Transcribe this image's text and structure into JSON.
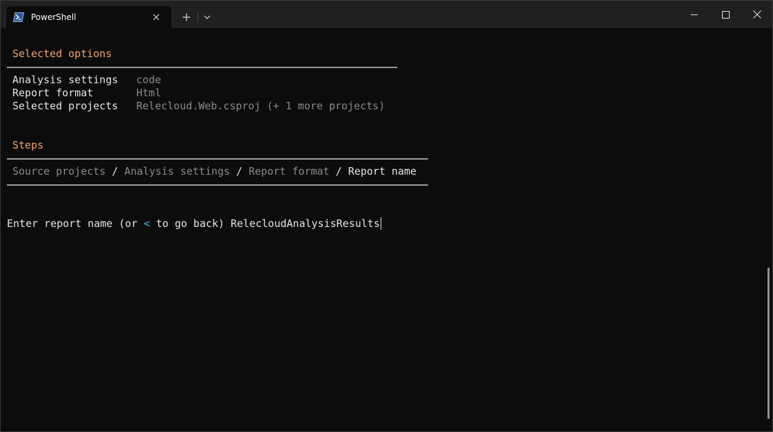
{
  "window": {
    "tab_title": "PowerShell"
  },
  "colors": {
    "heading": "#f2a36a",
    "value": "#8a8a8a",
    "label": "#e4e4e4",
    "accent": "#3fc1d4",
    "background": "#0c0c0c",
    "titlebar": "#202020"
  },
  "icons": {
    "tab": "powershell-icon",
    "tab_close": "close-icon",
    "new_tab": "plus-icon",
    "dropdown": "chevron-down-icon",
    "minimize": "minimize-icon",
    "maximize": "maximize-icon",
    "close": "close-icon"
  },
  "selected_options": {
    "heading": "Selected options",
    "rows": [
      {
        "label": "Analysis settings",
        "value": "code"
      },
      {
        "label": "Report format",
        "value": "Html"
      },
      {
        "label": "Selected projects",
        "value": "Relecloud.Web.csproj (+ 1 more projects)"
      }
    ]
  },
  "steps": {
    "heading": "Steps",
    "items": [
      {
        "label": "Source projects",
        "state": "done"
      },
      {
        "label": "Analysis settings",
        "state": "done"
      },
      {
        "label": "Report format",
        "state": "done"
      },
      {
        "label": "Report name",
        "state": "current"
      }
    ],
    "separator": " / "
  },
  "prompt": {
    "text_before": "Enter report name (or ",
    "back_key": "<",
    "text_after": " to go back) ",
    "input_value": "RelecloudAnalysisResults"
  }
}
